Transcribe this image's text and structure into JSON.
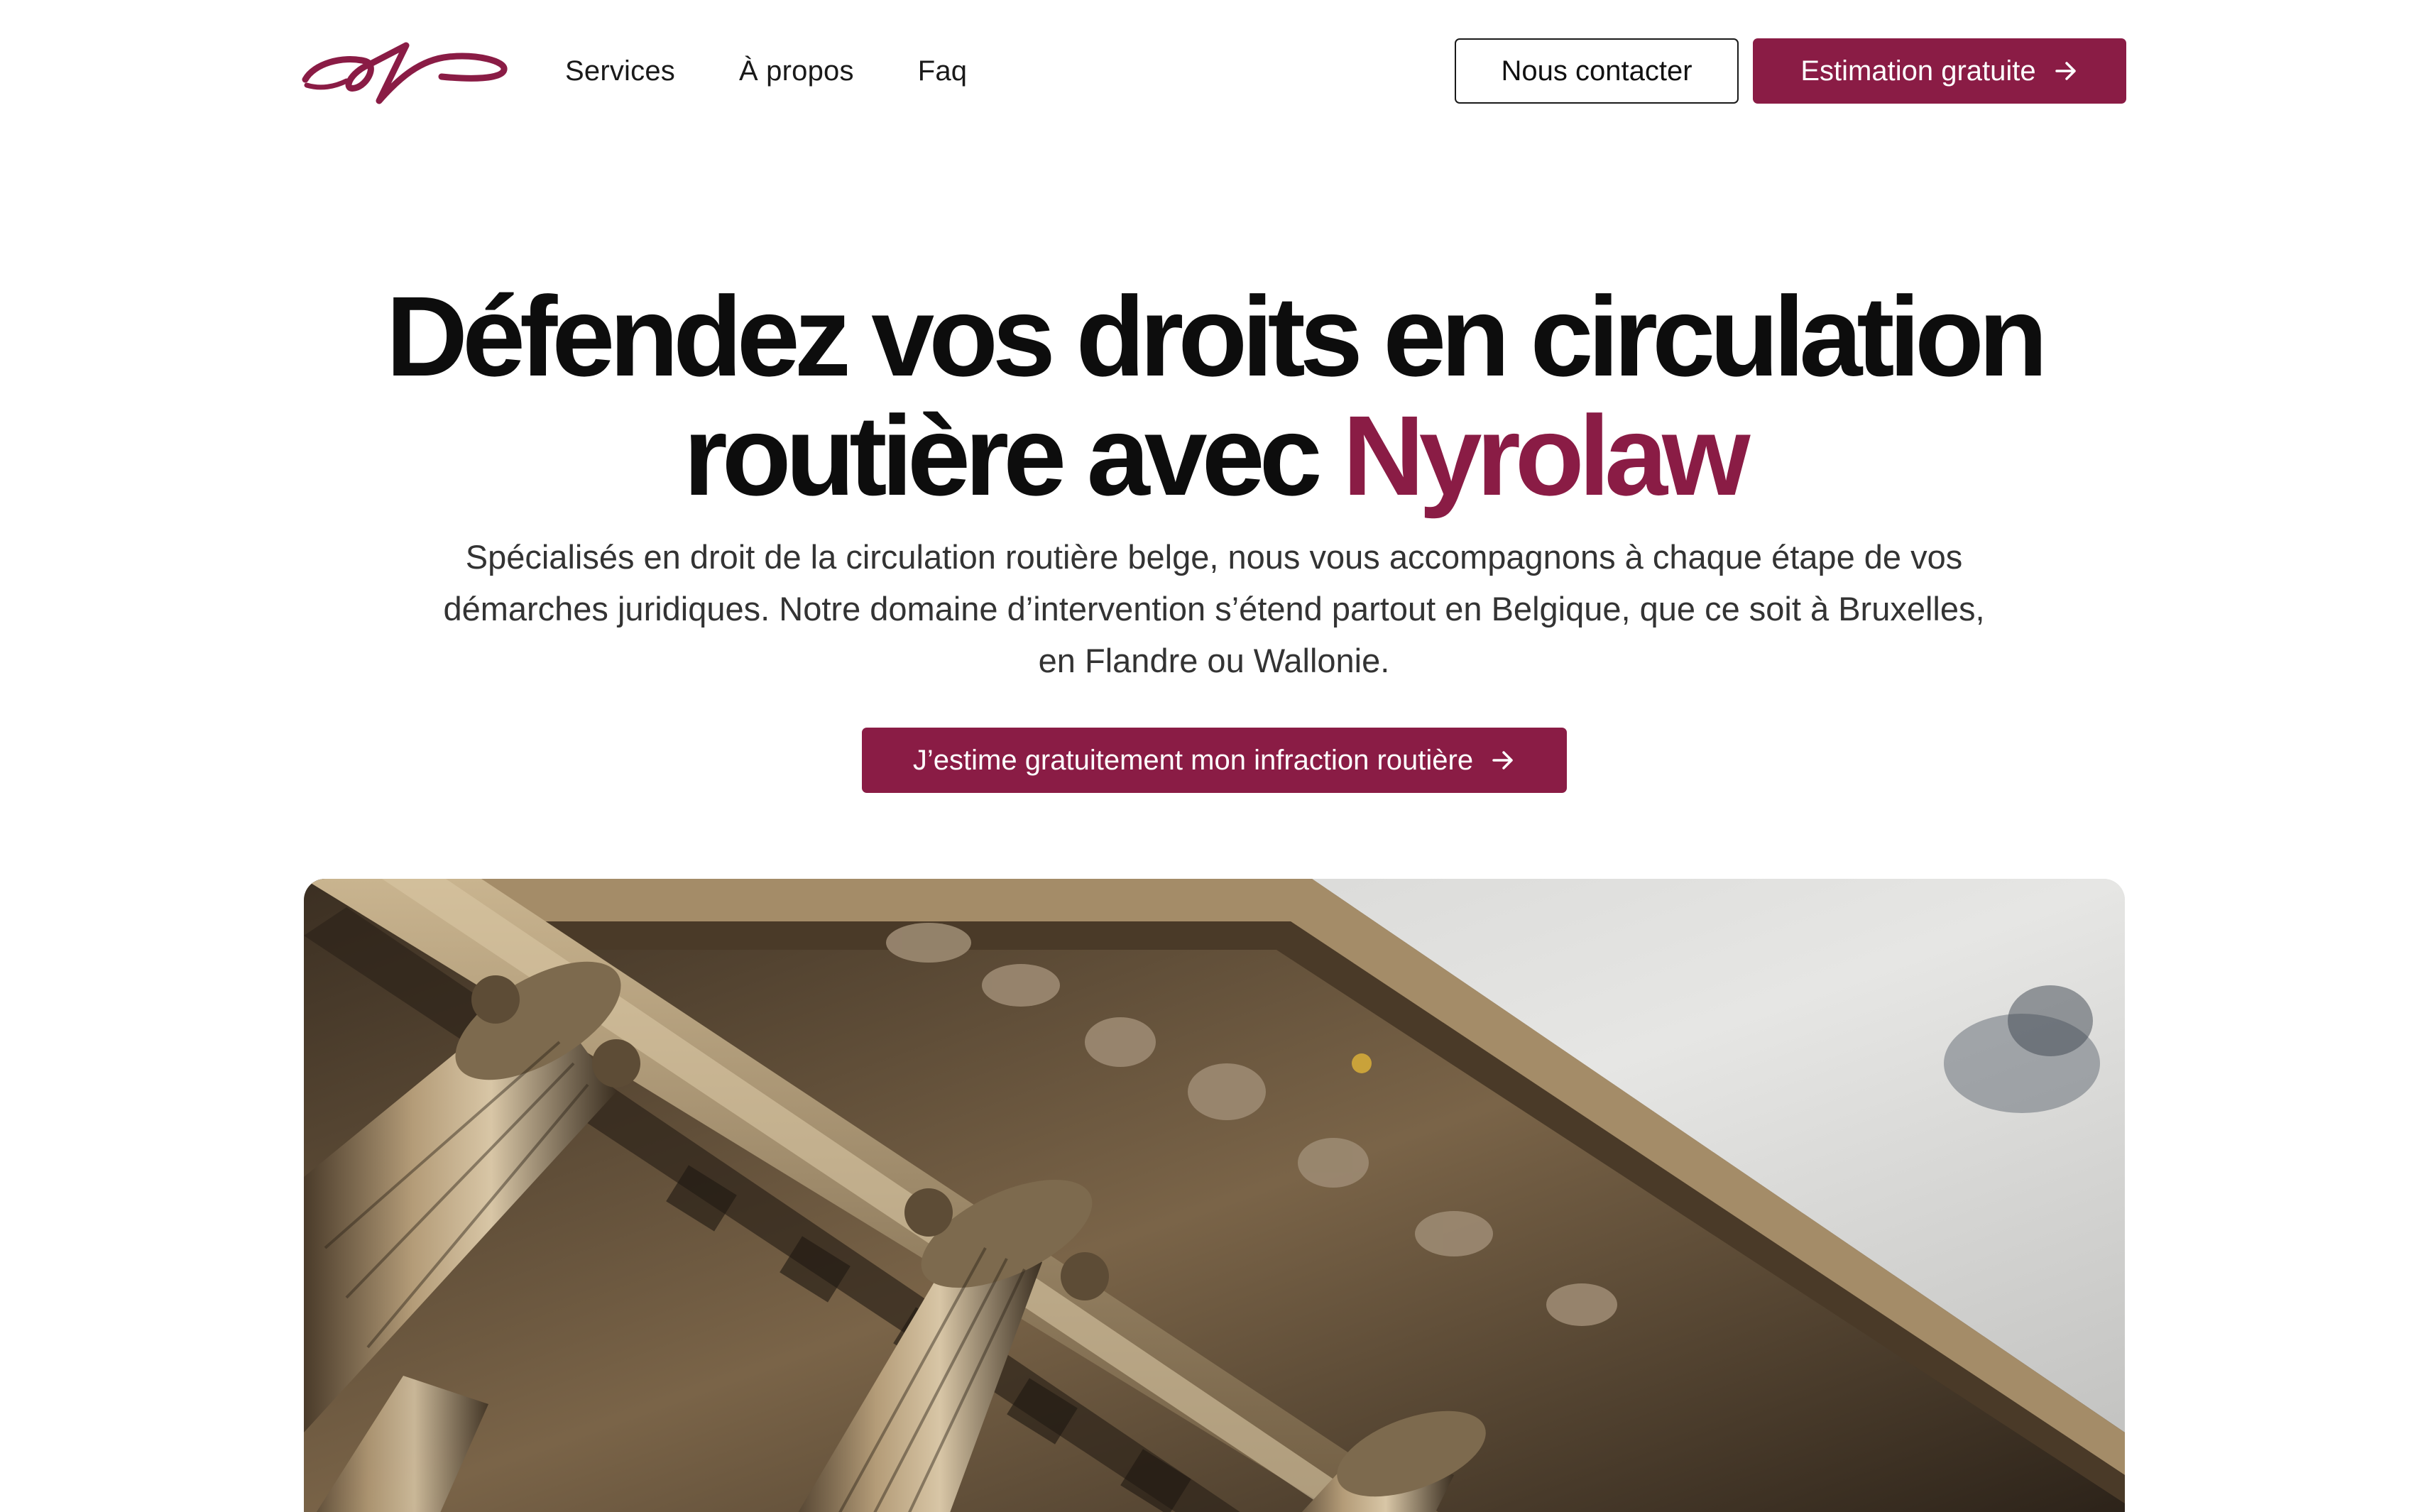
{
  "nav": {
    "logo_name": "nyrolaw-logo",
    "links": [
      "Services",
      "À propos",
      "Faq"
    ],
    "contact_label": "Nous contacter",
    "estimate_label": "Estimation gratuite"
  },
  "hero": {
    "title_line1": "Défendez vos droits en circulation",
    "title_line2_prefix": "routière avec ",
    "title_brand": "Nyrolaw",
    "subtitle": "Spécialisés en droit de la circulation routière belge, nous vous accompagnons à chaque étape de vos démarches juridiques. Notre domaine d’intervention s’étend partout en Belgique, que ce soit à Bruxelles, en Flandre ou Wallonie.",
    "cta_label": "J’estime gratuitement mon infraction routière"
  },
  "image": {
    "subject": "courthouse-columns-photo"
  },
  "colors": {
    "brand": "#8a1c45",
    "text": "#0d0d0d",
    "muted": "#333333",
    "background": "#ffffff"
  },
  "icons": [
    "arrow-right-icon"
  ]
}
